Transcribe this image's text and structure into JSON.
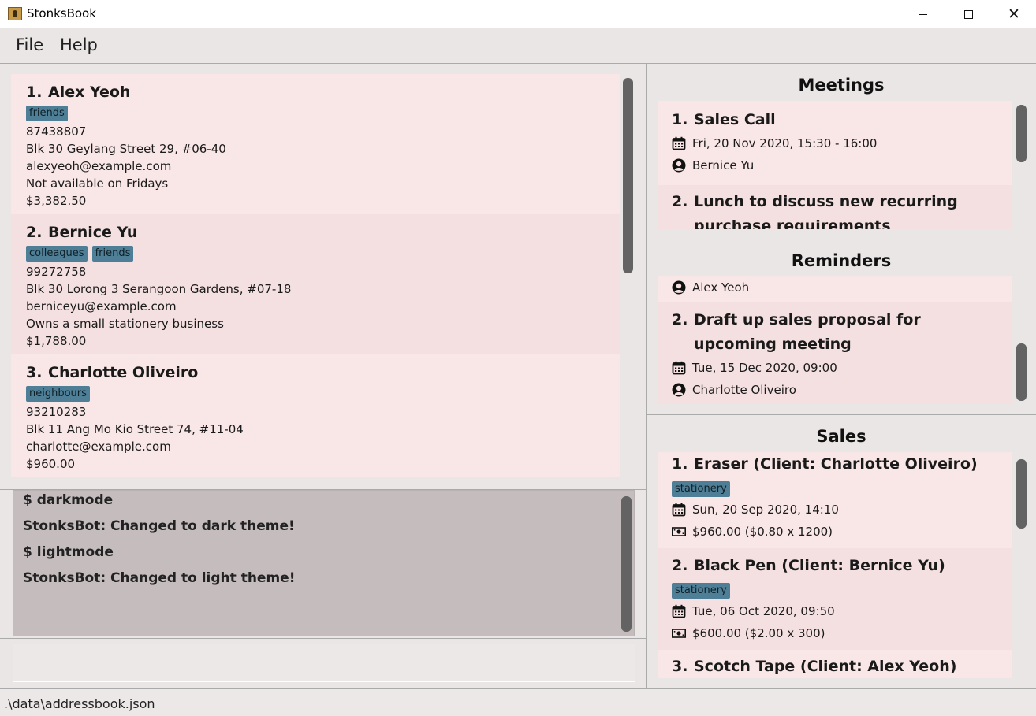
{
  "window": {
    "title": "StonksBook"
  },
  "menu": {
    "file": "File",
    "help": "Help"
  },
  "persons": [
    {
      "index": "1.",
      "name": "Alex Yeoh",
      "tags": [
        "friends"
      ],
      "phone": "87438807",
      "address": "Blk 30 Geylang Street 29, #06-40",
      "email": "alexyeoh@example.com",
      "remark": "Not available on Fridays",
      "total": "$3,382.50"
    },
    {
      "index": "2.",
      "name": "Bernice Yu",
      "tags": [
        "colleagues",
        "friends"
      ],
      "phone": "99272758",
      "address": "Blk 30 Lorong 3 Serangoon Gardens, #07-18",
      "email": "berniceyu@example.com",
      "remark": "Owns a small stationery business",
      "total": "$1,788.00"
    },
    {
      "index": "3.",
      "name": "Charlotte Oliveiro",
      "tags": [
        "neighbours"
      ],
      "phone": "93210283",
      "address": "Blk 11 Ang Mo Kio Street 74, #11-04",
      "email": "charlotte@example.com",
      "total": "$960.00"
    }
  ],
  "result": {
    "lines": [
      "$ darkmode",
      "StonksBot: Changed to dark theme!",
      "$ lightmode",
      "StonksBot: Changed to light theme!"
    ]
  },
  "command": {
    "value": ""
  },
  "status": {
    "path": ".\\data\\addressbook.json"
  },
  "meetings": {
    "title": "Meetings",
    "items": [
      {
        "index": "1.",
        "title": "Sales Call",
        "datetime": "Fri, 20 Nov 2020, 15:30 - 16:00",
        "contact": "Bernice Yu"
      },
      {
        "index": "2.",
        "title": "Lunch to discuss new recurring purchase requirements"
      }
    ]
  },
  "reminders": {
    "title": "Reminders",
    "items": [
      {
        "contact": "Alex Yeoh"
      },
      {
        "index": "2.",
        "title": "Draft up sales proposal for upcoming meeting",
        "datetime": "Tue, 15 Dec 2020, 09:00",
        "contact": "Charlotte Oliveiro"
      }
    ]
  },
  "sales": {
    "title": "Sales",
    "items": [
      {
        "index": "1.",
        "title": "Eraser (Client: Charlotte Oliveiro)",
        "tag": "stationery",
        "datetime": "Sun, 20 Sep 2020, 14:10",
        "amount": "$960.00 ($0.80 x 1200)"
      },
      {
        "index": "2.",
        "title": "Black Pen (Client: Bernice Yu)",
        "tag": "stationery",
        "datetime": "Tue, 06 Oct 2020, 09:50",
        "amount": "$600.00 ($2.00 x 300)"
      },
      {
        "index": "3.",
        "title": "Scotch Tape (Client: Alex Yeoh)"
      }
    ]
  },
  "icons": {
    "calendar": "calendar-icon",
    "person": "person-icon",
    "money": "money-icon"
  },
  "colors": {
    "tag": "#4e7f97",
    "card_light": "#f9e6e6",
    "card_dark": "#f4e0e0",
    "result_bg": "#c4bcbd"
  }
}
